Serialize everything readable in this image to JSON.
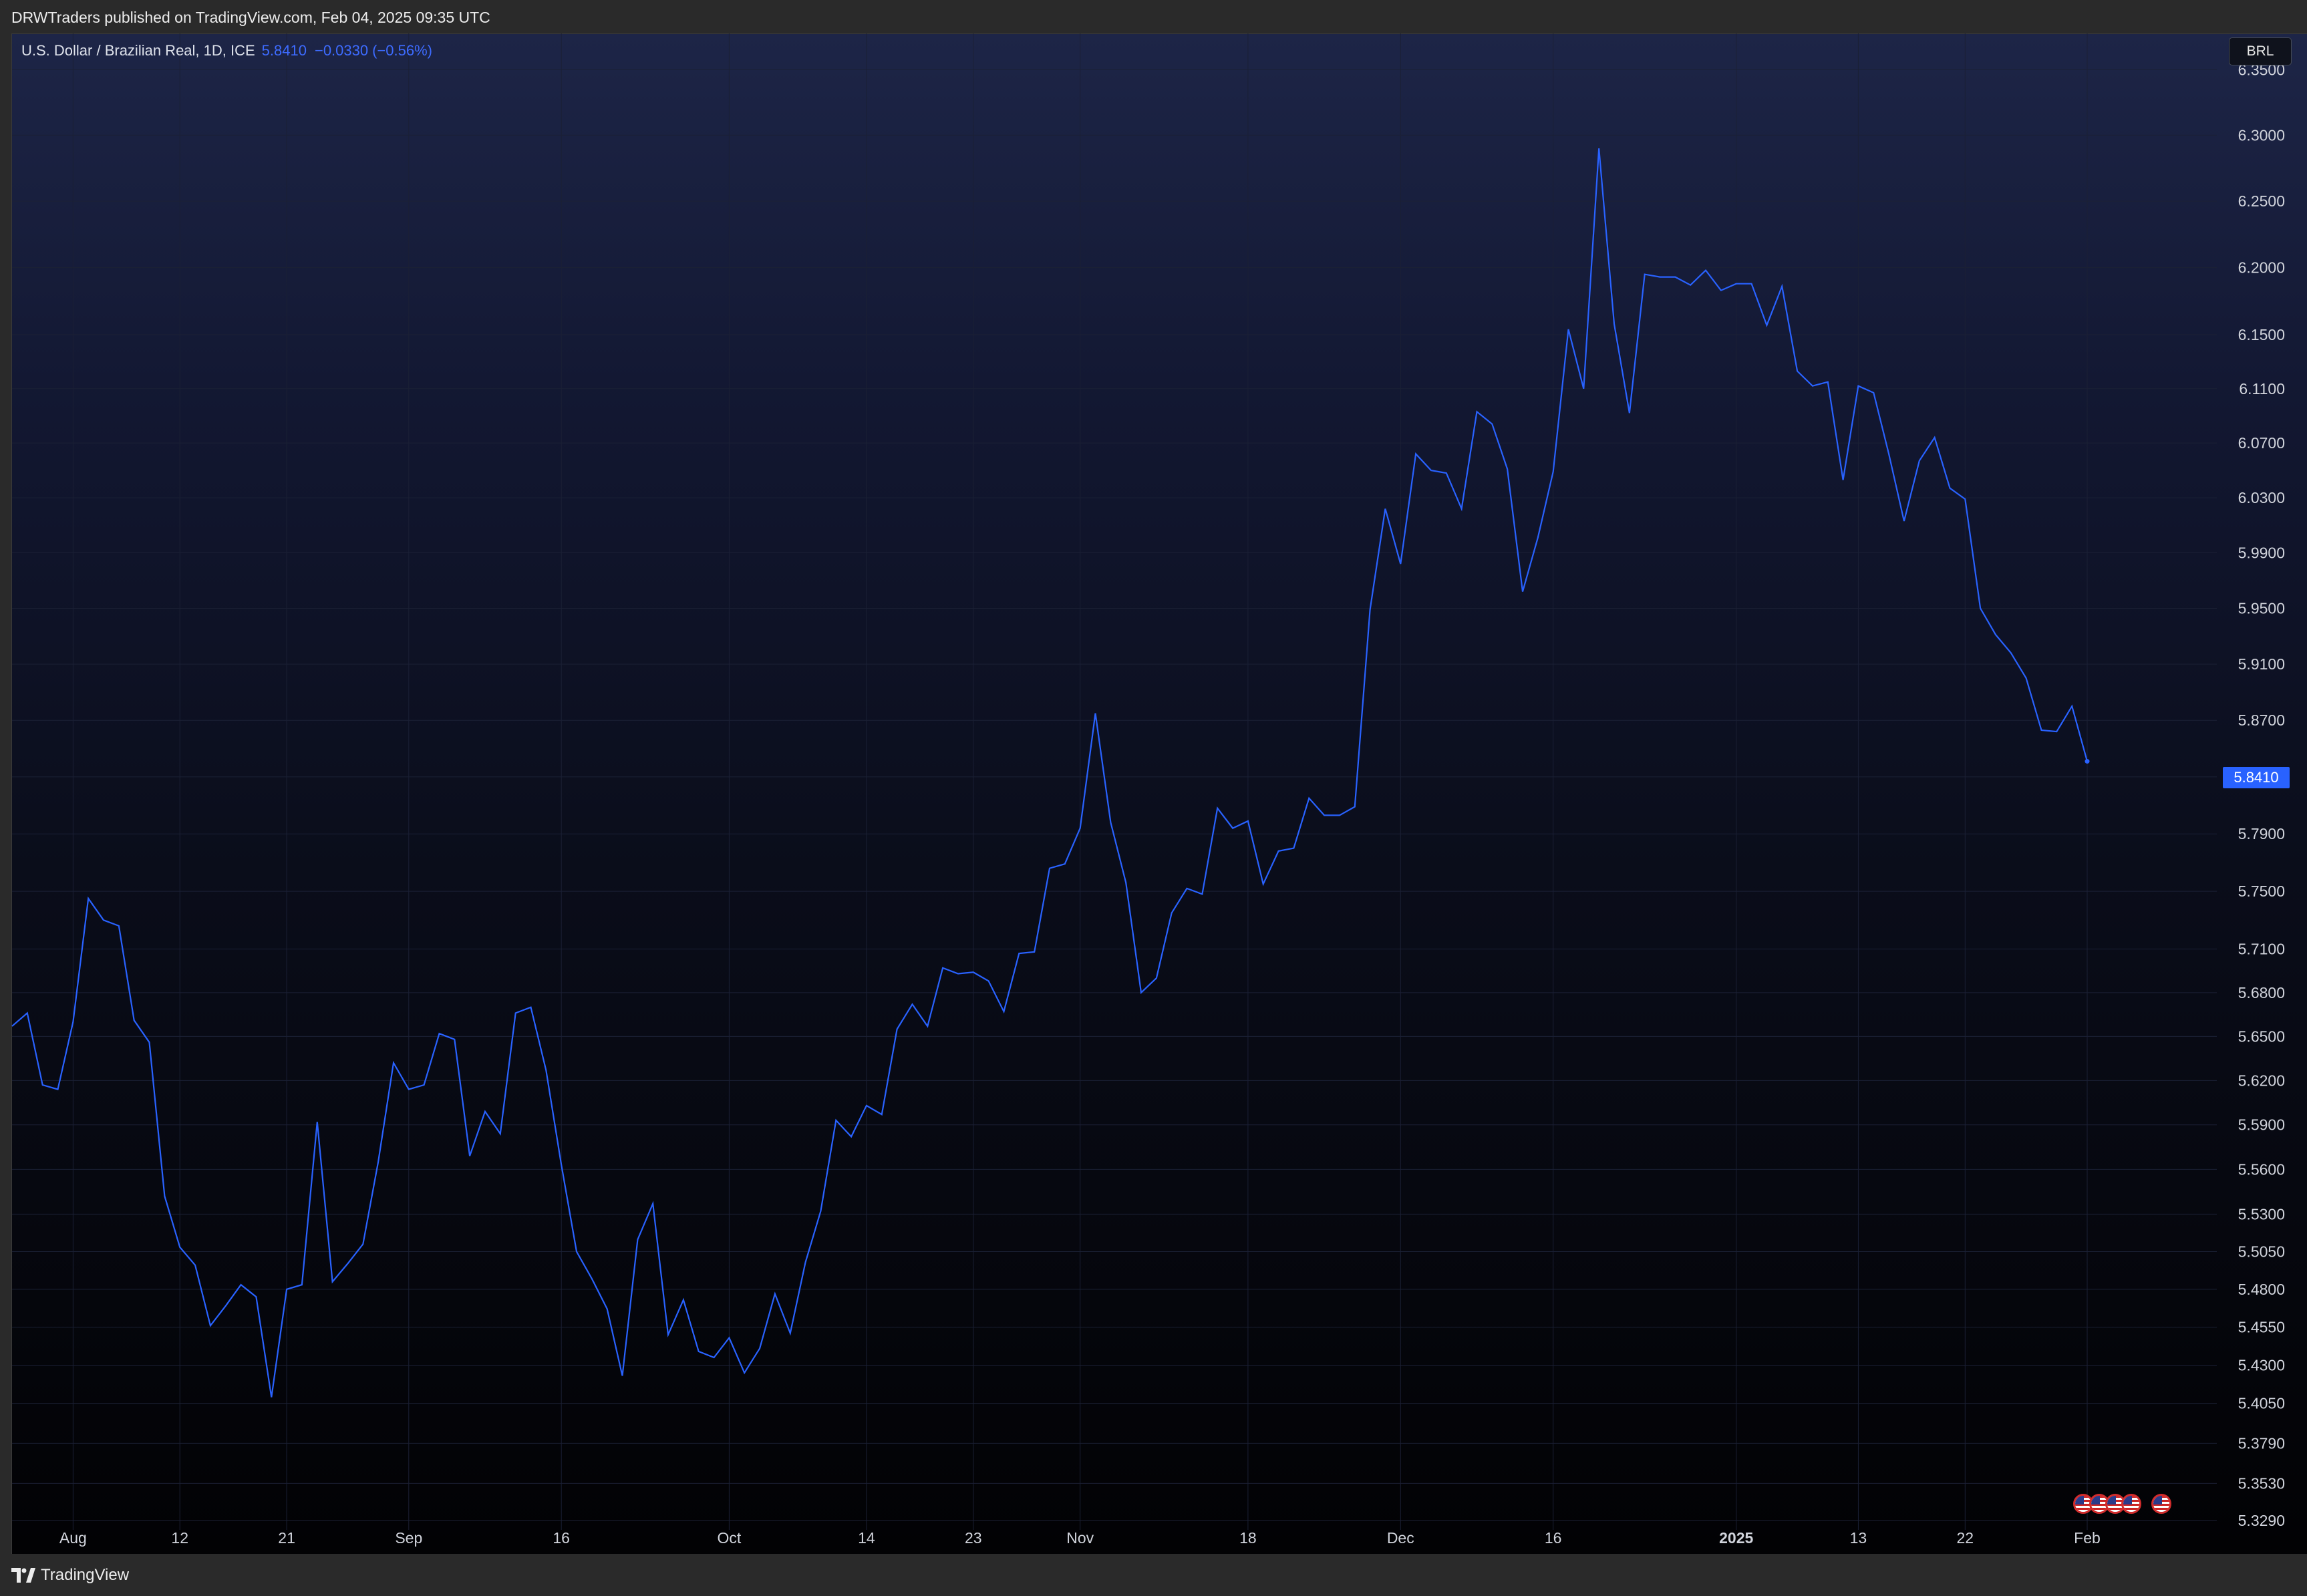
{
  "header": {
    "published_text": "DRWTraders published on TradingView.com, Feb 04, 2025 09:35 UTC"
  },
  "legend": {
    "symbol_text": "U.S. Dollar / Brazilian Real, 1D, ICE",
    "last_value": "5.8410",
    "change": "−0.0330",
    "change_pct": "(−0.56%)"
  },
  "currency_badge": "BRL",
  "price_tag": "5.8410",
  "footer": {
    "brand": "TradingView"
  },
  "colors": {
    "line": "#2962ff",
    "accent_text": "#3d6bff",
    "axis_text": "#d1d4dc",
    "grid": "#1b2035"
  },
  "chart_data": {
    "type": "line",
    "title": "",
    "xlabel": "",
    "ylabel": "",
    "x_axis_ticks": [
      {
        "label": "Aug",
        "index": 4
      },
      {
        "label": "12",
        "index": 11
      },
      {
        "label": "21",
        "index": 18
      },
      {
        "label": "Sep",
        "index": 26
      },
      {
        "label": "16",
        "index": 36
      },
      {
        "label": "Oct",
        "index": 47
      },
      {
        "label": "14",
        "index": 56
      },
      {
        "label": "23",
        "index": 63
      },
      {
        "label": "Nov",
        "index": 70
      },
      {
        "label": "18",
        "index": 81
      },
      {
        "label": "Dec",
        "index": 91
      },
      {
        "label": "16",
        "index": 101
      },
      {
        "label": "2025",
        "index": 113,
        "bold": true
      },
      {
        "label": "13",
        "index": 121
      },
      {
        "label": "22",
        "index": 128
      },
      {
        "label": "Feb",
        "index": 136
      }
    ],
    "y_ticks": [
      "6.3500",
      "6.3000",
      "6.2500",
      "6.2000",
      "6.1500",
      "6.1100",
      "6.0700",
      "6.0300",
      "5.9900",
      "5.9500",
      "5.9100",
      "5.8700",
      "5.8300",
      "5.7900",
      "5.7500",
      "5.7100",
      "5.6800",
      "5.6500",
      "5.6200",
      "5.5900",
      "5.5600",
      "5.5300",
      "5.5050",
      "5.4800",
      "5.4550",
      "5.4300",
      "5.4050",
      "5.3790",
      "5.3530",
      "5.3290"
    ],
    "series": [
      {
        "values": [
          5.657,
          5.666,
          5.617,
          5.614,
          5.66,
          5.745,
          5.73,
          5.726,
          5.661,
          5.646,
          5.542,
          5.508,
          5.496,
          5.456,
          5.469,
          5.483,
          5.475,
          5.409,
          5.48,
          5.483,
          5.592,
          5.485,
          5.497,
          5.51,
          5.565,
          5.632,
          5.614,
          5.617,
          5.652,
          5.648,
          5.569,
          5.599,
          5.584,
          5.666,
          5.67,
          5.627,
          5.563,
          5.505,
          5.487,
          5.467,
          5.423,
          5.513,
          5.537,
          5.45,
          5.473,
          5.439,
          5.435,
          5.448,
          5.425,
          5.441,
          5.477,
          5.451,
          5.498,
          5.532,
          5.593,
          5.582,
          5.603,
          5.597,
          5.655,
          5.672,
          5.657,
          5.697,
          5.693,
          5.694,
          5.688,
          5.667,
          5.707,
          5.708,
          5.766,
          5.769,
          5.794,
          5.875,
          5.798,
          5.756,
          5.68,
          5.69,
          5.735,
          5.752,
          5.748,
          5.808,
          5.794,
          5.799,
          5.755,
          5.778,
          5.78,
          5.815,
          5.803,
          5.803,
          5.809,
          5.949,
          6.022,
          5.982,
          6.062,
          6.05,
          6.048,
          6.022,
          6.093,
          6.084,
          6.051,
          5.962,
          6.001,
          6.049,
          6.154,
          6.11,
          6.29,
          6.158,
          6.092,
          6.195,
          6.193,
          6.193,
          6.187,
          6.198,
          6.183,
          6.188,
          6.188,
          6.157,
          6.186,
          6.123,
          6.112,
          6.115,
          6.043,
          6.112,
          6.107,
          6.062,
          6.013,
          6.057,
          6.074,
          6.037,
          6.029,
          5.95,
          5.931,
          5.918,
          5.9,
          5.863,
          5.862,
          5.88,
          5.841
        ]
      }
    ],
    "ylim": [
      5.323,
      6.378
    ],
    "grid": true,
    "log_scale": true
  }
}
